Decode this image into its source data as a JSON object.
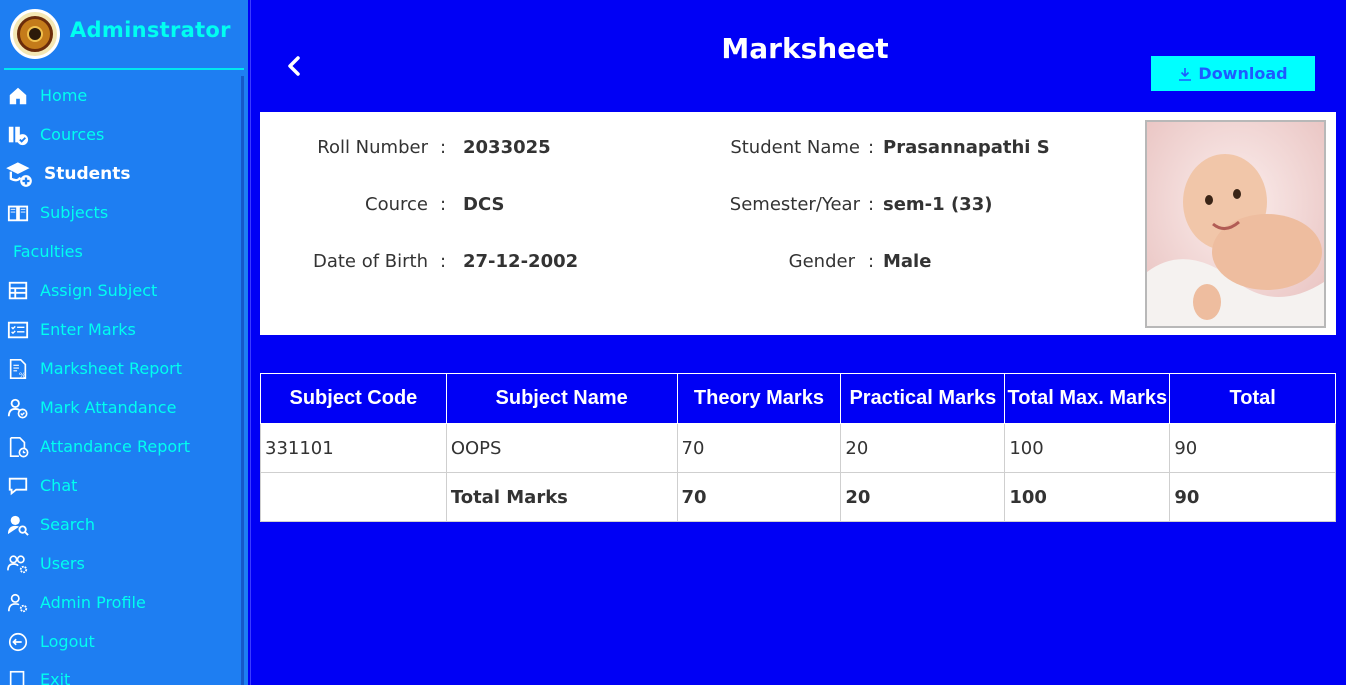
{
  "sidebar": {
    "brand_title": "Adminstrator",
    "items": [
      {
        "label": "Home",
        "icon": "home-icon"
      },
      {
        "label": "Cources",
        "icon": "books-check-icon"
      },
      {
        "label": "Students",
        "icon": "graduate-add-icon",
        "active": true
      },
      {
        "label": "Subjects",
        "icon": "open-book-icon"
      },
      {
        "label": "Faculties",
        "icon": ""
      },
      {
        "label": "Assign Subject",
        "icon": "assign-table-icon"
      },
      {
        "label": "Enter Marks",
        "icon": "marks-list-icon"
      },
      {
        "label": "Marksheet Report",
        "icon": "report-percent-icon"
      },
      {
        "label": "Mark Attandance",
        "icon": "user-check-icon"
      },
      {
        "label": "Attandance Report",
        "icon": "document-clock-icon"
      },
      {
        "label": "Chat",
        "icon": "chat-bubble-icon"
      },
      {
        "label": "Search",
        "icon": "user-search-icon"
      },
      {
        "label": "Users",
        "icon": "users-gear-icon"
      },
      {
        "label": "Admin Profile",
        "icon": "user-gear-icon"
      },
      {
        "label": "Logout",
        "icon": "logout-icon"
      },
      {
        "label": "Exit",
        "icon": "exit-icon"
      }
    ]
  },
  "header": {
    "title": "Marksheet",
    "download_label": "Download"
  },
  "student": {
    "roll_label": "Roll Number",
    "roll_value": "2033025",
    "name_label": "Student Name",
    "name_value": "Prasannapathi S",
    "course_label": "Cource",
    "course_value": "DCS",
    "semester_label": "Semester/Year",
    "semester_value": "sem-1 (33)",
    "dob_label": "Date of Birth",
    "dob_value": "27-12-2002",
    "gender_label": "Gender",
    "gender_value": "Male",
    "separator": ":"
  },
  "marks_table": {
    "headers": [
      "Subject Code",
      "Subject Name",
      "Theory Marks",
      "Practical Marks",
      "Total Max. Marks",
      "Total"
    ],
    "rows": [
      [
        "331101",
        "OOPS",
        "70",
        "20",
        "100",
        "90"
      ]
    ],
    "total_row": [
      "",
      "Total Marks",
      "70",
      "20",
      "100",
      "90"
    ]
  },
  "colors": {
    "background": "#0000f5",
    "sidebar": "#1e7ef2",
    "accent_text": "#00fff0",
    "download_button": "#00ffff"
  }
}
